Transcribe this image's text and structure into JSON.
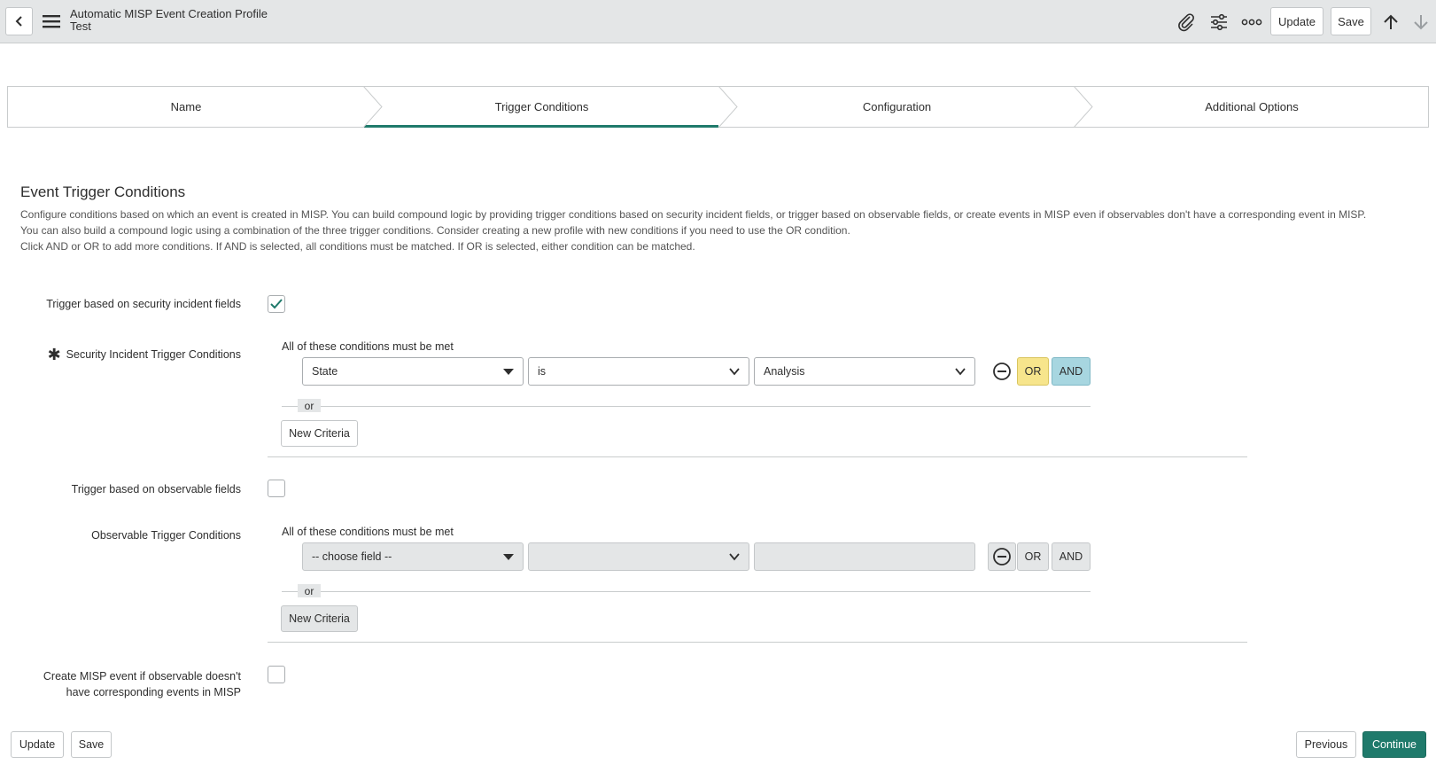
{
  "header": {
    "record_type": "Automatic MISP Event Creation Profile",
    "record_name": "Test",
    "update_label": "Update",
    "save_label": "Save"
  },
  "steps": [
    {
      "label": "Name",
      "active": false
    },
    {
      "label": "Trigger Conditions",
      "active": true
    },
    {
      "label": "Configuration",
      "active": false
    },
    {
      "label": "Additional Options",
      "active": false
    }
  ],
  "section": {
    "title": "Event Trigger Conditions",
    "desc1": "Configure conditions based on which an event is created in MISP. You can build compound logic by providing trigger conditions based on security incident fields, or trigger based on observable fields, or create events in MISP even if observables don't have a corresponding event in MISP.",
    "desc2": "You can also build a compound logic using a combination of the three trigger conditions. Consider creating a new profile with new conditions if you need to use the OR condition.",
    "desc3": "Click AND or OR to add more conditions. If AND is selected, all conditions must be matched. If OR is selected, either condition can be matched."
  },
  "fields": {
    "si_trigger_label": "Trigger based on security incident fields",
    "si_trigger_checked": true,
    "si_conditions_label": "Security Incident Trigger Conditions",
    "obs_trigger_label": "Trigger based on observable fields",
    "obs_trigger_checked": false,
    "obs_conditions_label": "Observable Trigger Conditions",
    "create_misp_label_1": "Create MISP event if observable doesn't",
    "create_misp_label_2": "have corresponding events in MISP",
    "create_misp_checked": false
  },
  "si_condition": {
    "heading": "All of these conditions must be met",
    "field": "State",
    "operator": "is",
    "value": "Analysis",
    "or_label": "OR",
    "and_label": "AND",
    "or_sep": "or",
    "new_criteria": "New Criteria"
  },
  "obs_condition": {
    "heading": "All of these conditions must be met",
    "field": "-- choose field --",
    "operator": "",
    "value": "",
    "or_label": "OR",
    "and_label": "AND",
    "or_sep": "or",
    "new_criteria": "New Criteria"
  },
  "footer": {
    "update_label": "Update",
    "save_label": "Save",
    "previous_label": "Previous",
    "continue_label": "Continue"
  },
  "colors": {
    "accent": "#1f7a6b",
    "or_active": "#f7e58c",
    "and_active": "#a7d6e0"
  }
}
